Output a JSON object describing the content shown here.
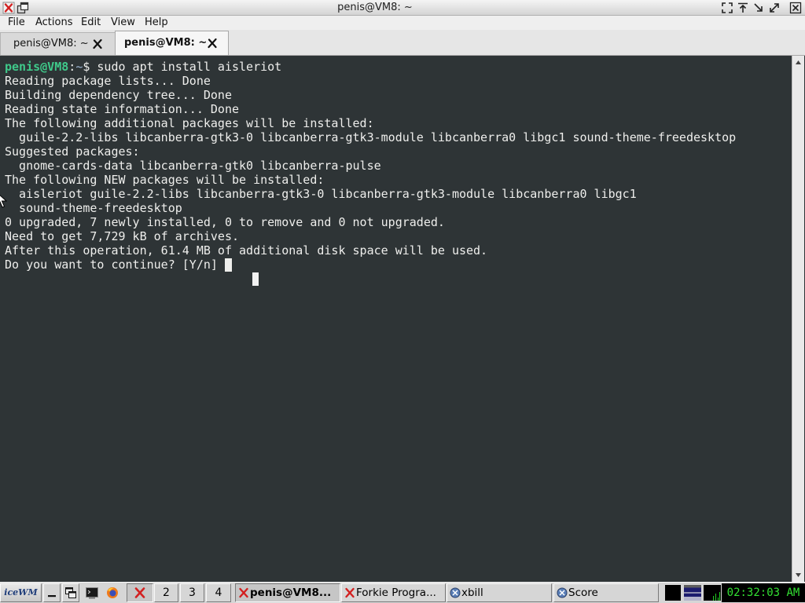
{
  "window": {
    "title": "penis@VM8: ~",
    "left_icons": [
      "x11-app-icon",
      "window-menu-icon"
    ],
    "controls": [
      "fullscreen-icon",
      "rollup-icon",
      "minimize-icon",
      "maximize-icon",
      "close-icon"
    ]
  },
  "menu": {
    "items": [
      {
        "label": "File"
      },
      {
        "label": "Actions"
      },
      {
        "label": "Edit"
      },
      {
        "label": "View"
      },
      {
        "label": "Help"
      }
    ]
  },
  "tabs": [
    {
      "label": "penis@VM8: ~",
      "active": false
    },
    {
      "label": "penis@VM8: ~",
      "active": true
    }
  ],
  "terminal": {
    "prompt": {
      "user_host": "penis@VM8",
      "separator": ":",
      "path": "~",
      "symbol": "$ ",
      "command": "sudo apt install aisleriot"
    },
    "output": [
      "Reading package lists... Done",
      "Building dependency tree... Done",
      "Reading state information... Done",
      "The following additional packages will be installed:",
      "  guile-2.2-libs libcanberra-gtk3-0 libcanberra-gtk3-module libcanberra0 libgc1 sound-theme-freedesktop",
      "Suggested packages:",
      "  gnome-cards-data libcanberra-gtk0 libcanberra-pulse",
      "The following NEW packages will be installed:",
      "  aisleriot guile-2.2-libs libcanberra-gtk3-0 libcanberra-gtk3-module libcanberra0 libgc1",
      "  sound-theme-freedesktop",
      "0 upgraded, 7 newly installed, 0 to remove and 0 not upgraded.",
      "Need to get 7,729 kB of archives.",
      "After this operation, 61.4 MB of additional disk space will be used."
    ],
    "input_prompt": "Do you want to continue? [Y/n] "
  },
  "taskbar": {
    "logo_text": "iceWM",
    "buttons": [
      "show-desktop-icon",
      "window-list-icon"
    ],
    "launchers": [
      "terminal-icon",
      "firefox-icon"
    ],
    "workspaces": [
      {
        "icon": "x11-icon",
        "active": true
      },
      {
        "label": "2",
        "active": false
      },
      {
        "label": "3",
        "active": false
      },
      {
        "label": "4",
        "active": false
      }
    ],
    "tasks": [
      {
        "label": "penis@VM8...",
        "icon": "x11-icon",
        "active": true
      },
      {
        "label": "Forkie Progra...",
        "icon": "x11-icon",
        "active": false
      },
      {
        "label": "xbill",
        "icon": "app-icon",
        "active": false
      },
      {
        "label": "Score",
        "icon": "app-icon",
        "active": false
      }
    ],
    "tray": [
      "monitor-icon",
      "network-monitor-icon",
      "cpu-monitor-icon"
    ],
    "clock": "02:32:03 AM"
  },
  "colors": {
    "term_bg": "#2e3436",
    "term_fg": "#eeeeec",
    "prompt_user": "#3fc98a",
    "prompt_path": "#9fb7d6",
    "clock_fg": "#33e033",
    "x11_red": "#d32020"
  }
}
